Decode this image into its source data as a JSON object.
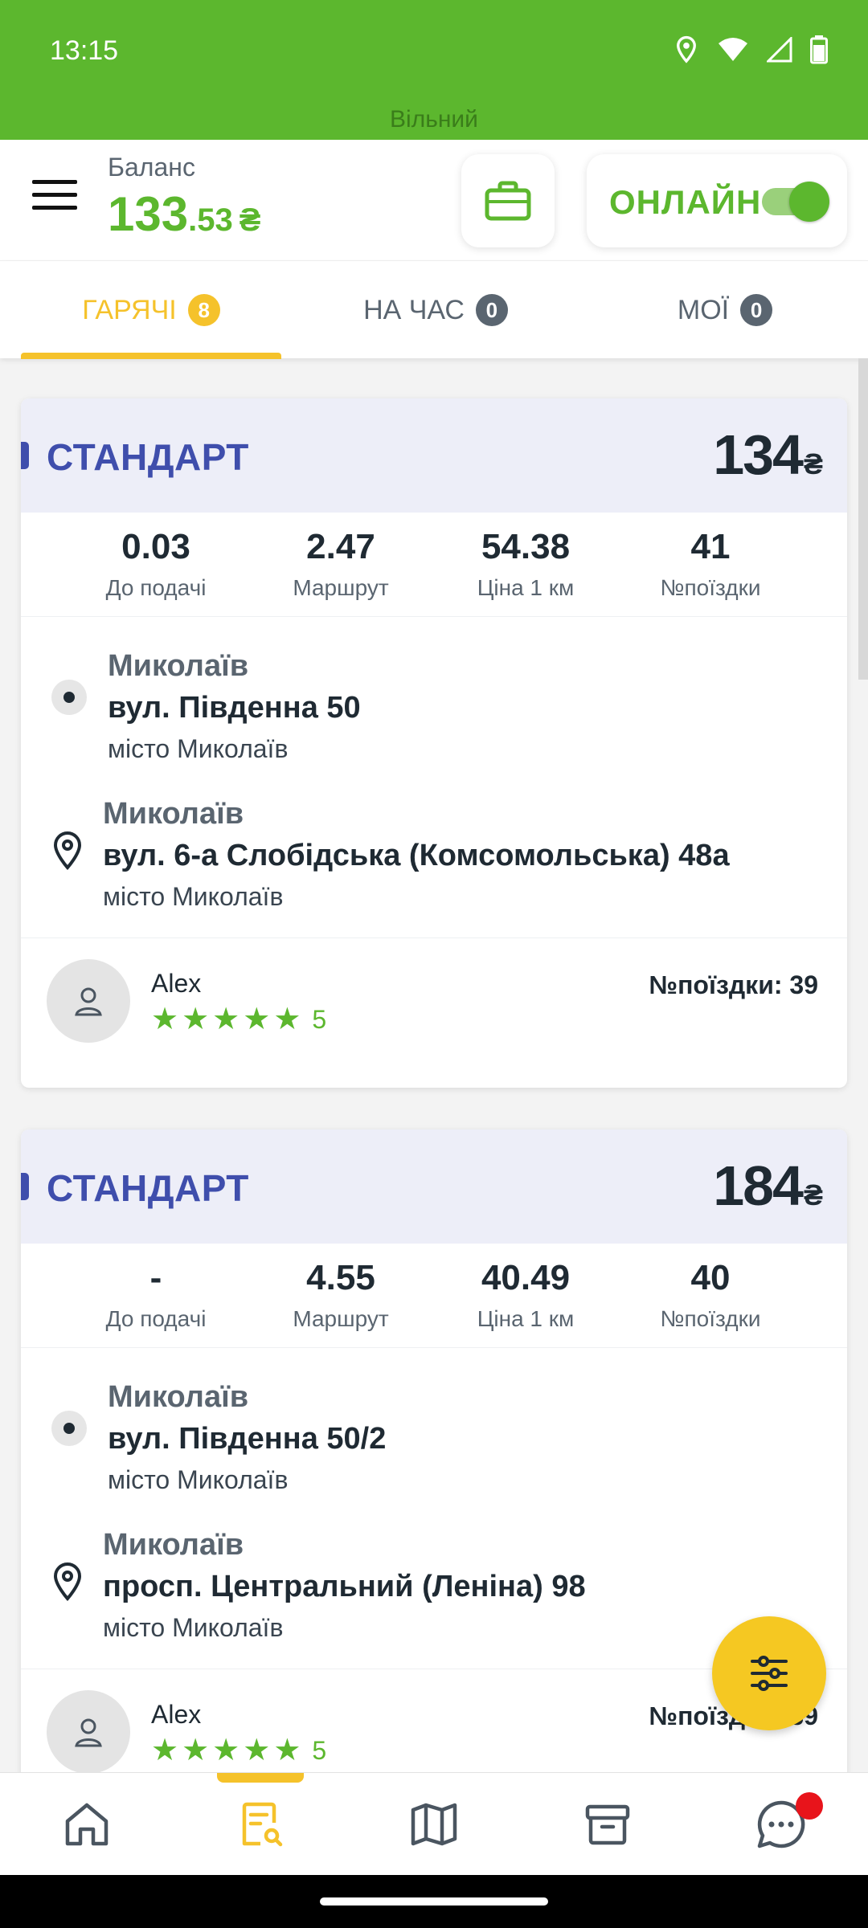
{
  "status_bar": {
    "time": "13:15",
    "icons": [
      "location-icon",
      "wifi-icon",
      "signal-icon",
      "battery-icon"
    ],
    "driver_status": "Вільний"
  },
  "header": {
    "balance_label": "Баланс",
    "balance_int": "133",
    "balance_frac": ".53",
    "currency": "₴",
    "online_label": "ОНЛАЙН",
    "online_enabled": true,
    "colors": {
      "brand_green": "#5cb72e",
      "accent_yellow": "#f5c22b",
      "header_blue": "#3f4eac"
    }
  },
  "tabs": [
    {
      "label": "ГАРЯЧІ",
      "count": "8",
      "active": true
    },
    {
      "label": "НА ЧАС",
      "count": "0",
      "active": false
    },
    {
      "label": "МОЇ",
      "count": "0",
      "active": false
    }
  ],
  "orders": [
    {
      "type": "СТАНДАРТ",
      "price": "134",
      "currency": "₴",
      "stats": [
        {
          "value": "0.03",
          "label": "До подачі"
        },
        {
          "value": "2.47",
          "label": "Маршрут"
        },
        {
          "value": "54.38",
          "label": "Ціна 1 км"
        },
        {
          "value": "41",
          "label": "№поїздки"
        }
      ],
      "from": {
        "city": "Миколаїв",
        "street": "вул. Південна 50",
        "sub": "місто Миколаїв"
      },
      "to": {
        "city": "Миколаїв",
        "street": "вул. 6-а Слобідська (Комсомольська) 48а",
        "sub": "місто Миколаїв"
      },
      "client": {
        "name": "Alex",
        "stars": 5,
        "rating": "5",
        "trip": "№поїздки: 39"
      }
    },
    {
      "type": "СТАНДАРТ",
      "price": "184",
      "currency": "₴",
      "stats": [
        {
          "value": "-",
          "label": "До подачі"
        },
        {
          "value": "4.55",
          "label": "Маршрут"
        },
        {
          "value": "40.49",
          "label": "Ціна 1 км"
        },
        {
          "value": "40",
          "label": "№поїздки"
        }
      ],
      "from": {
        "city": "Миколаїв",
        "street": "вул. Південна 50/2",
        "sub": "місто Миколаїв"
      },
      "to": {
        "city": "Миколаїв",
        "street": "просп. Центральний (Леніна) 98",
        "sub": "місто Миколаїв"
      },
      "client": {
        "name": "Alex",
        "stars": 5,
        "rating": "5",
        "trip": "№поїздки: 39"
      }
    }
  ],
  "bottom_nav": [
    "home-icon",
    "orders-search-icon",
    "map-icon",
    "archive-icon",
    "chat-icon"
  ]
}
